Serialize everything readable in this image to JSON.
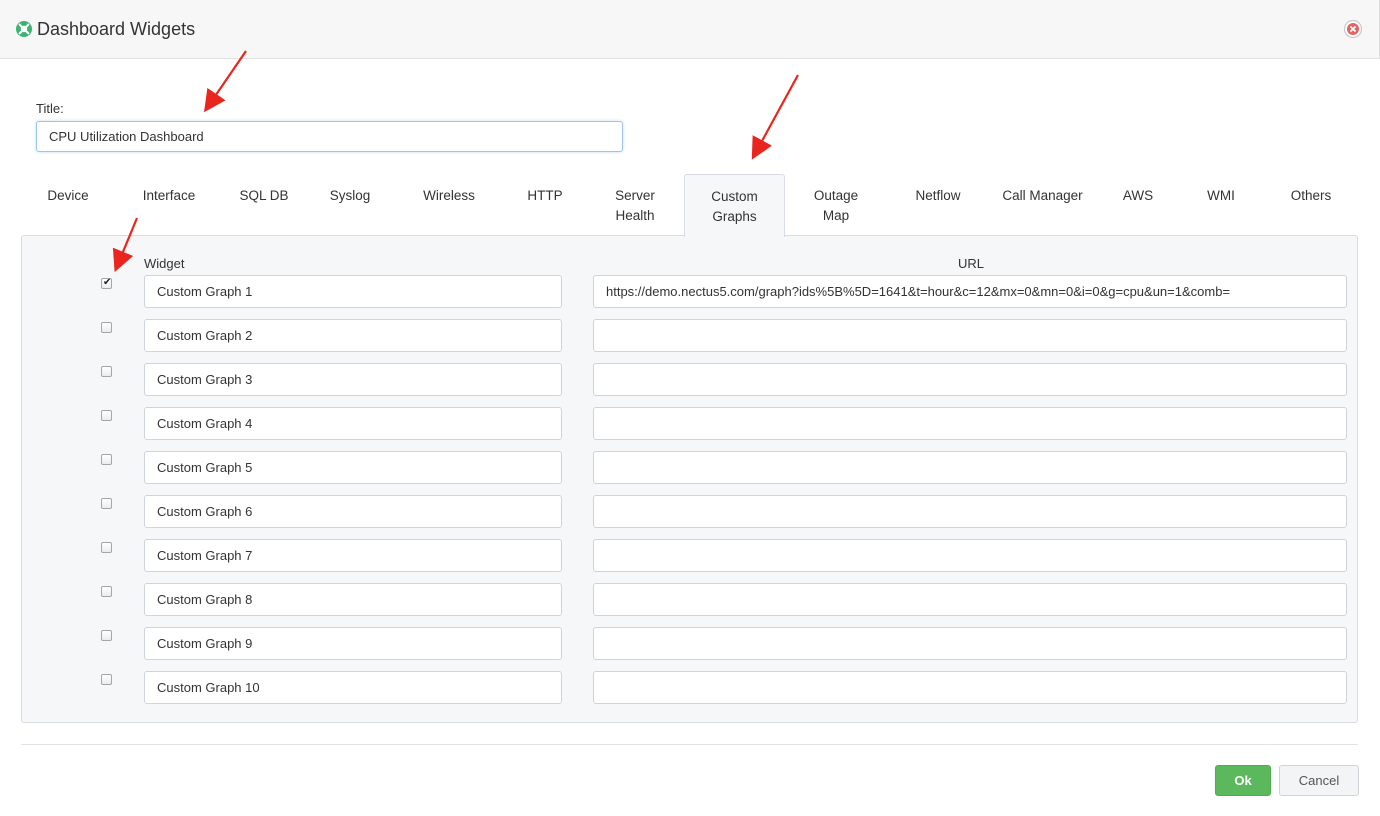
{
  "dialog": {
    "title": "Dashboard Widgets",
    "icon": "green-circle-icon",
    "close_icon": "close-circle-icon"
  },
  "title_field": {
    "label": "Title:",
    "value": "CPU Utilization Dashboard"
  },
  "tabs": [
    {
      "label": "Device"
    },
    {
      "label": "Interface"
    },
    {
      "label": "SQL DB"
    },
    {
      "label": "Syslog"
    },
    {
      "label": "Wireless"
    },
    {
      "label": "HTTP"
    },
    {
      "label": "Server\nHealth"
    },
    {
      "label": "Custom\nGraphs",
      "active": true
    },
    {
      "label": "Outage\nMap"
    },
    {
      "label": "Netflow"
    },
    {
      "label": "Call Manager"
    },
    {
      "label": "AWS"
    },
    {
      "label": "WMI"
    },
    {
      "label": "Others"
    }
  ],
  "table": {
    "widget_header": "Widget",
    "url_header": "URL",
    "rows": [
      {
        "checked": true,
        "widget": "Custom Graph 1",
        "url": "https://demo.nectus5.com/graph?ids%5B%5D=1641&t=hour&c=12&mx=0&mn=0&i=0&g=cpu&un=1&comb="
      },
      {
        "checked": false,
        "widget": "Custom Graph 2",
        "url": ""
      },
      {
        "checked": false,
        "widget": "Custom Graph 3",
        "url": ""
      },
      {
        "checked": false,
        "widget": "Custom Graph 4",
        "url": ""
      },
      {
        "checked": false,
        "widget": "Custom Graph 5",
        "url": ""
      },
      {
        "checked": false,
        "widget": "Custom Graph 6",
        "url": ""
      },
      {
        "checked": false,
        "widget": "Custom Graph 7",
        "url": ""
      },
      {
        "checked": false,
        "widget": "Custom Graph 8",
        "url": ""
      },
      {
        "checked": false,
        "widget": "Custom Graph 9",
        "url": ""
      },
      {
        "checked": false,
        "widget": "Custom Graph 10",
        "url": ""
      }
    ]
  },
  "footer": {
    "ok_label": "Ok",
    "cancel_label": "Cancel"
  },
  "colors": {
    "ok_button": "#5cb85c",
    "annotation_arrow": "#e8251e",
    "logo": "#3cb371",
    "close": "#d9534f"
  }
}
